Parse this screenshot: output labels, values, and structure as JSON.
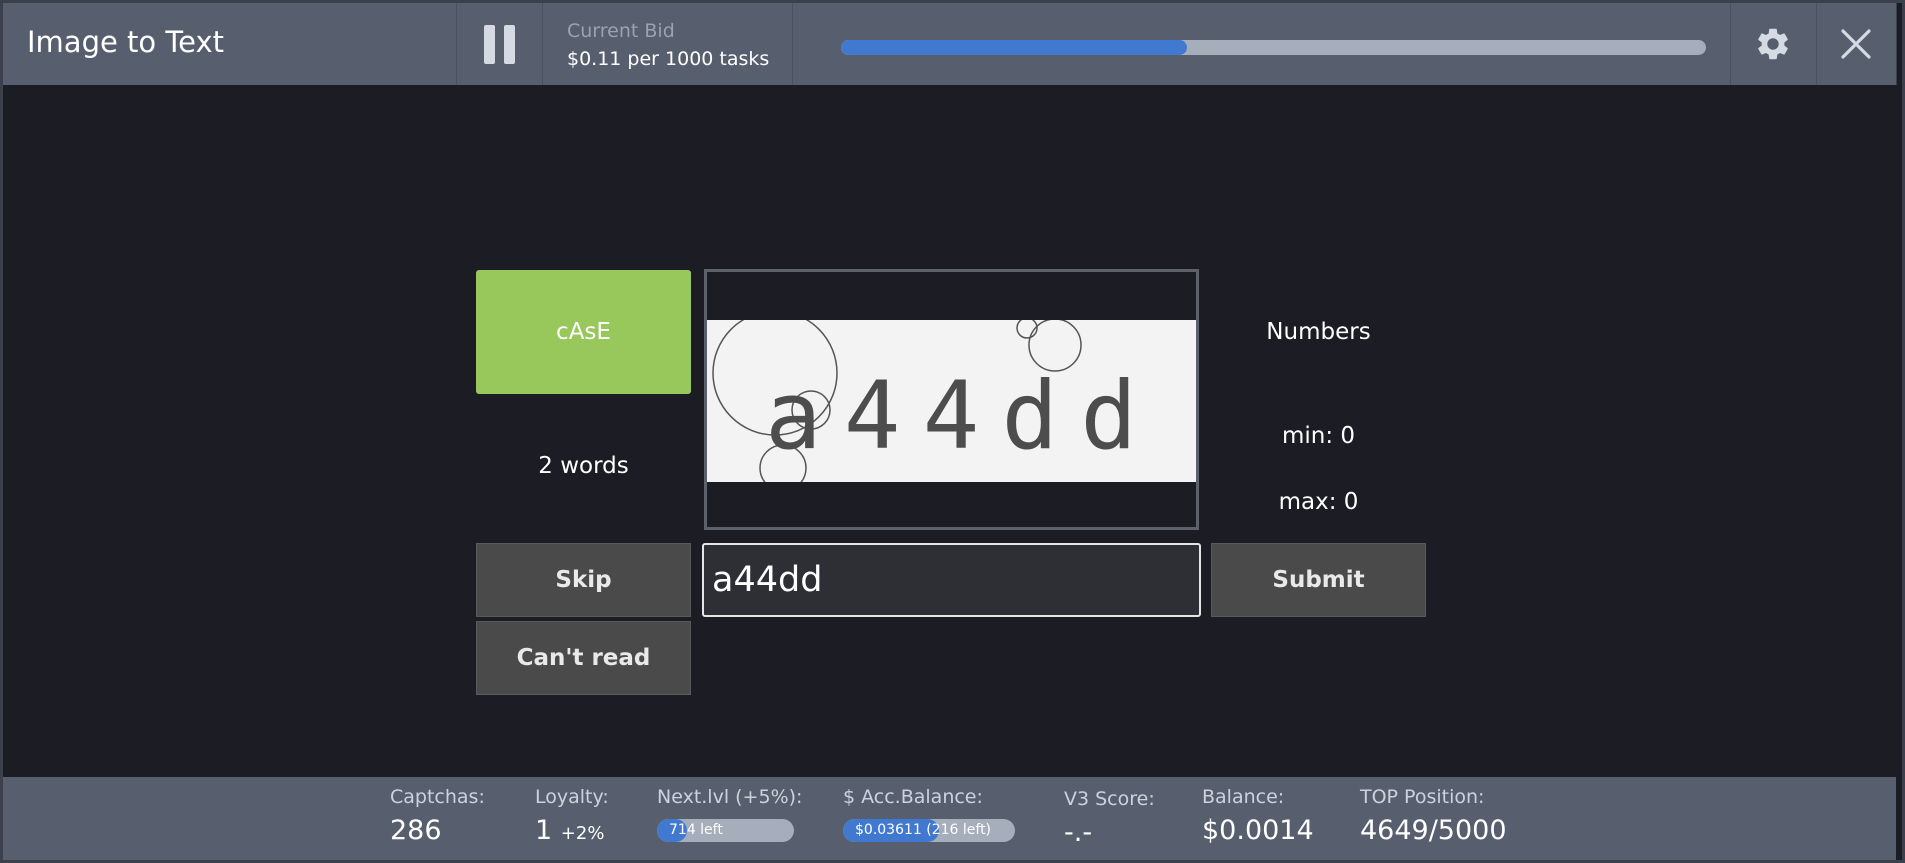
{
  "header": {
    "title": "Image to Text",
    "bid_label": "Current Bid",
    "bid_value": "$0.11 per 1000 tasks",
    "progress_fraction": 0.4,
    "pause_icon": "pause-icon",
    "settings_icon": "gear-icon",
    "close_icon": "close-icon"
  },
  "task": {
    "case_label": "cAsE",
    "words_label": "2 words",
    "numbers_label": "Numbers",
    "min_label": "min: 0",
    "max_label": "max: 0",
    "captcha_text": "a44dd",
    "answer_value": "a44dd",
    "skip_label": "Skip",
    "cant_read_label": "Can't read",
    "submit_label": "Submit"
  },
  "footer": {
    "captchas": {
      "label": "Captchas:",
      "value": "286"
    },
    "loyalty": {
      "label": "Loyalty:",
      "value": "1",
      "bonus": "+2%"
    },
    "next_level": {
      "label": "Next.lvl (+5%):",
      "bar_text": "714 left",
      "progress_fraction": 0.22
    },
    "acc_balance": {
      "label": "$ Acc.Balance:",
      "bar_text": "$0.03611 (216 left)",
      "progress_fraction": 0.56
    },
    "v3_score": {
      "label": "V3 Score:",
      "value": "-.-"
    },
    "balance": {
      "label": "Balance:",
      "value": "$0.0014"
    },
    "top_position": {
      "label": "TOP Position:",
      "value": "4649/5000"
    }
  },
  "colors": {
    "accent_blue": "#4279d0",
    "case_green": "#98c75b",
    "header_bg": "#575f6f",
    "main_bg": "#1b1c24"
  }
}
